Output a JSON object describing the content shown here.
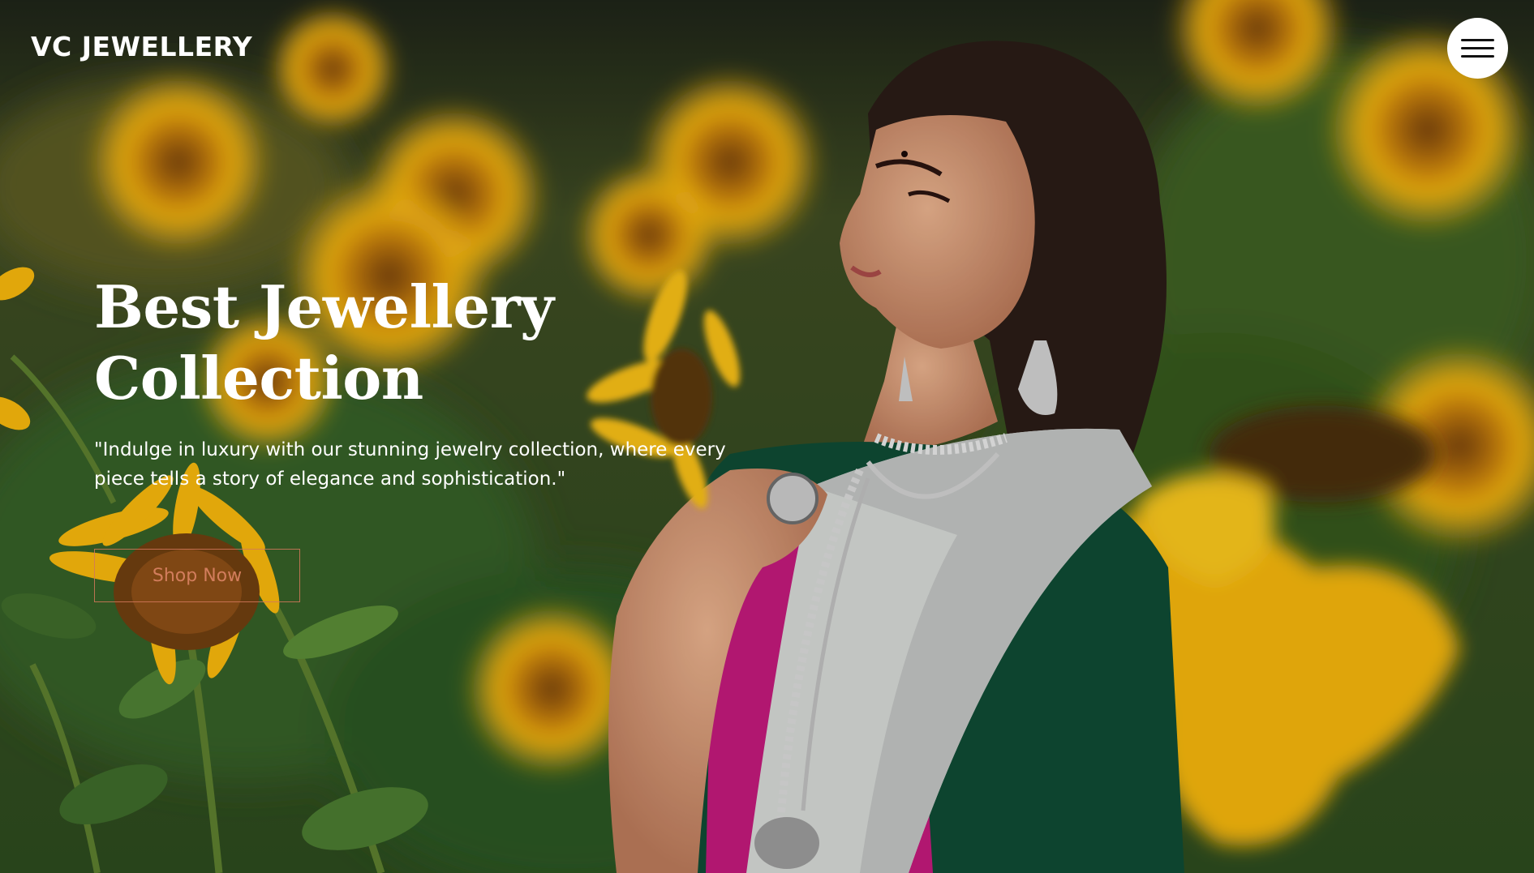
{
  "brand": {
    "name": "VC JEWELLERY"
  },
  "navbar": {
    "menu_icon": "hamburger-menu-icon"
  },
  "hero": {
    "title": "Best Jewellery Collection",
    "description": "\"Indulge in luxury with our stunning jewelry collection, where every piece tells a story of elegance and sophistication.\"",
    "cta_label": "Shop Now",
    "background_image": "woman wearing silver jewellery in a sunflower field"
  },
  "colors": {
    "text": "#ffffff",
    "cta_text": "#d27d5c",
    "cta_border": "#d2785a",
    "menu_button_bg": "#ffffff",
    "menu_bar": "#111111",
    "sunflower": "#f5b80f",
    "foliage": "#2f5a24"
  }
}
